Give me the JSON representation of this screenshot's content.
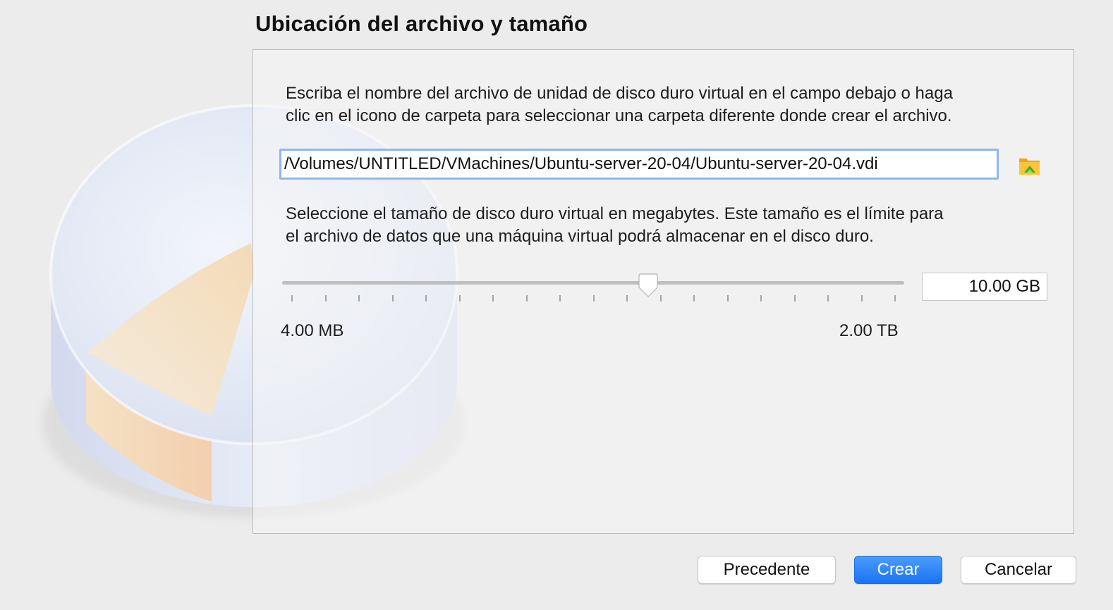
{
  "page": {
    "title": "Ubicación del archivo y tamaño"
  },
  "location": {
    "description_lines": [
      "Escriba el nombre del archivo de unidad de disco duro virtual en el campo debajo o haga",
      "clic en el icono de carpeta para seleccionar una carpeta diferente donde crear el archivo."
    ],
    "file_path": "/Volumes/UNTITLED/VMachines/Ubuntu-server-20-04/Ubuntu-server-20-04.vdi",
    "folder_icon": "folder-open-icon"
  },
  "size": {
    "description_lines": [
      "Seleccione el tamaño de disco duro virtual en megabytes. Este tamaño es el límite para",
      "el archivo de datos que una máquina virtual podrá almacenar en el disco duro."
    ],
    "value": "10.00 GB",
    "min_label": "4.00 MB",
    "max_label": "2.00 TB",
    "slider_position_fraction": 0.588,
    "tick_count": 19
  },
  "buttons": {
    "back": "Precedente",
    "create": "Crear",
    "cancel": "Cancelar"
  },
  "colors": {
    "accent": "#1a74f2",
    "input_focus": "#8db7f0",
    "folder": "#f4b400",
    "folder_arrow": "#3fae2a"
  }
}
